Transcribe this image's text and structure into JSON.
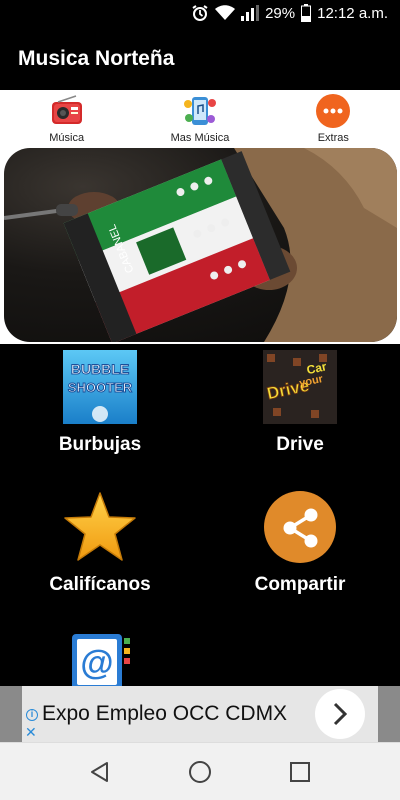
{
  "status_bar": {
    "battery": "29%",
    "time": "12:12 a.m."
  },
  "app": {
    "title": "Musica Norteña"
  },
  "tabs": [
    {
      "label": "Música",
      "icon": "radio-icon"
    },
    {
      "label": "Mas Música",
      "icon": "phone-music-icon"
    },
    {
      "label": "Extras",
      "icon": "more-dots-icon"
    }
  ],
  "banner": {
    "image": "accordion-player-photo",
    "accordion_text": "CABANEL"
  },
  "grid": [
    {
      "label": "Burbujas",
      "icon": "bubble-shooter-icon",
      "icon_text": [
        "BUBBLE",
        "SHOOTER"
      ]
    },
    {
      "label": "Drive",
      "icon": "drive-your-car-icon",
      "icon_text": [
        "Drive",
        "your",
        "Car"
      ]
    },
    {
      "label": "Califícanos",
      "icon": "star-icon"
    },
    {
      "label": "Compartir",
      "icon": "share-icon"
    },
    {
      "label": "",
      "icon": "email-at-icon"
    }
  ],
  "ad": {
    "text": "Expo Empleo OCC CDMX"
  },
  "colors": {
    "app_bar": "#000000",
    "tab_bg": "#ffffff",
    "extras_orange": "#f0641e",
    "share_orange": "#e08a2a",
    "star_yellow": "#f5b51e"
  }
}
